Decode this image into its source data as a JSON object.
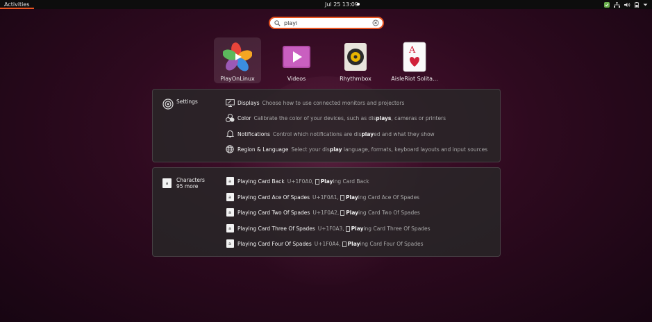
{
  "topbar": {
    "activities": "Activities",
    "clock": "Jul 25  13:09"
  },
  "search": {
    "value": "playi"
  },
  "apps": [
    {
      "label": "PlayOnLinux",
      "icon": "playonlinux-icon"
    },
    {
      "label": "Videos",
      "icon": "videos-icon"
    },
    {
      "label": "Rhythmbox",
      "icon": "rhythmbox-icon"
    },
    {
      "label": "AisleRiot Solita...",
      "icon": "aisleriot-icon"
    }
  ],
  "settings": {
    "provider": "Settings",
    "rows": [
      {
        "title": "Displays",
        "desc_pre": "Choose how to use connected monitors and projectors",
        "desc_bold": "",
        "desc_post": "",
        "icon": "display-icon"
      },
      {
        "title": "Color",
        "desc_pre": "Calibrate the color of your devices, such as dis",
        "desc_bold": "plays",
        "desc_post": ", cameras or printers",
        "icon": "color-icon"
      },
      {
        "title": "Notifications",
        "desc_pre": "Control which notifications are dis",
        "desc_bold": "play",
        "desc_post": "ed and what they show",
        "icon": "bell-icon"
      },
      {
        "title": "Region & Language",
        "desc_pre": "Select your dis",
        "desc_bold": "play",
        "desc_post": " language, formats, keyboard layouts and input sources",
        "icon": "globe-icon"
      }
    ]
  },
  "characters": {
    "provider": "Characters",
    "more": "95 more",
    "rows": [
      {
        "title": "Playing Card Back",
        "code": "U+1F0A0,",
        "bold": "Play",
        "rest": "ing Card Back"
      },
      {
        "title": "Playing Card Ace Of Spades",
        "code": "U+1F0A1,",
        "bold": "Play",
        "rest": "ing Card Ace Of Spades"
      },
      {
        "title": "Playing Card Two Of Spades",
        "code": "U+1F0A2,",
        "bold": "Play",
        "rest": "ing Card Two Of Spades"
      },
      {
        "title": "Playing Card Three Of Spades",
        "code": "U+1F0A3,",
        "bold": "Play",
        "rest": "ing Card Three Of Spades"
      },
      {
        "title": "Playing Card Four Of Spades",
        "code": "U+1F0A4,",
        "bold": "Play",
        "rest": "ing Card Four Of Spades"
      }
    ]
  },
  "colors": {
    "accent": "#e95420",
    "panel": "#282828"
  }
}
